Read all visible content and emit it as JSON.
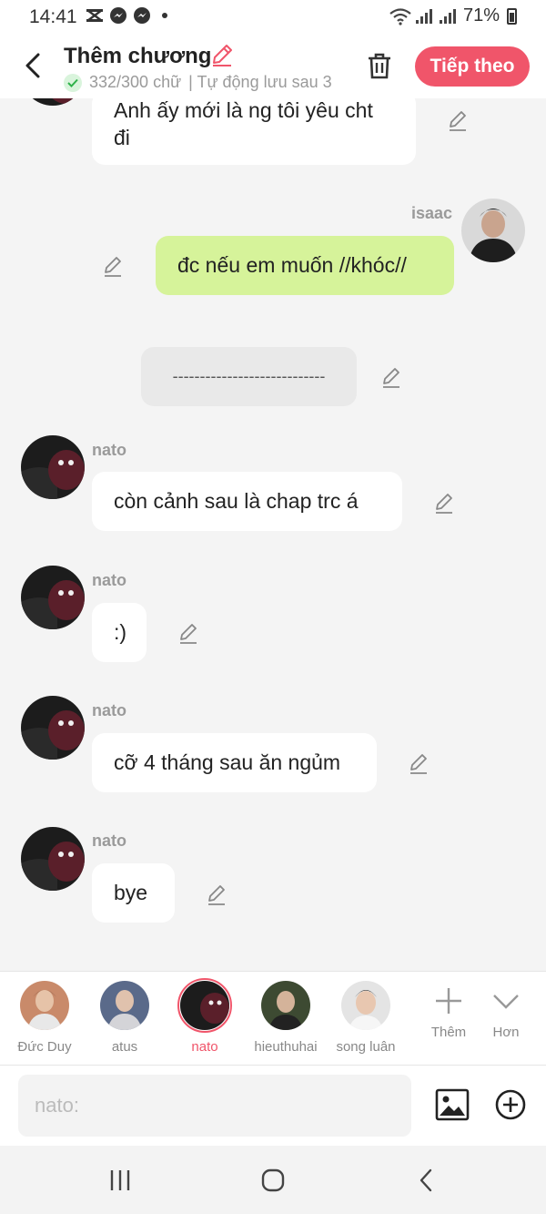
{
  "status_bar": {
    "time": "14:41",
    "battery": "71%"
  },
  "header": {
    "title": "Thêm chương",
    "word_count": "332/300 chữ",
    "autosave": "| Tự động lưu sau 3",
    "next_label": "Tiếp theo"
  },
  "messages": [
    {
      "sender": "",
      "text": "Anh ấy mới là ng tôi yêu cht đi",
      "side": "left"
    },
    {
      "sender": "isaac",
      "text": "đc nếu em muốn //khóc//",
      "side": "right"
    },
    {
      "sender": "",
      "text": "----------------------------",
      "side": "narration"
    },
    {
      "sender": "nato",
      "text": "còn cảnh sau là chap trc á",
      "side": "left"
    },
    {
      "sender": "nato",
      "text": ":)",
      "side": "left"
    },
    {
      "sender": "nato",
      "text": "cỡ 4 tháng sau ăn ngủm",
      "side": "left"
    },
    {
      "sender": "nato",
      "text": "bye",
      "side": "left"
    }
  ],
  "characters": [
    {
      "name": "Đức Duy",
      "selected": false
    },
    {
      "name": "atus",
      "selected": false
    },
    {
      "name": "nato",
      "selected": true
    },
    {
      "name": "hieuthuhai",
      "selected": false
    },
    {
      "name": "song luân",
      "selected": false
    }
  ],
  "tools": {
    "add_label": "Thêm",
    "more_label": "Hơn"
  },
  "input": {
    "placeholder": "nato:"
  },
  "colors": {
    "accent": "#f0556a",
    "green_bubble": "#d6f39a",
    "chat_bg": "#f4f4f4"
  }
}
